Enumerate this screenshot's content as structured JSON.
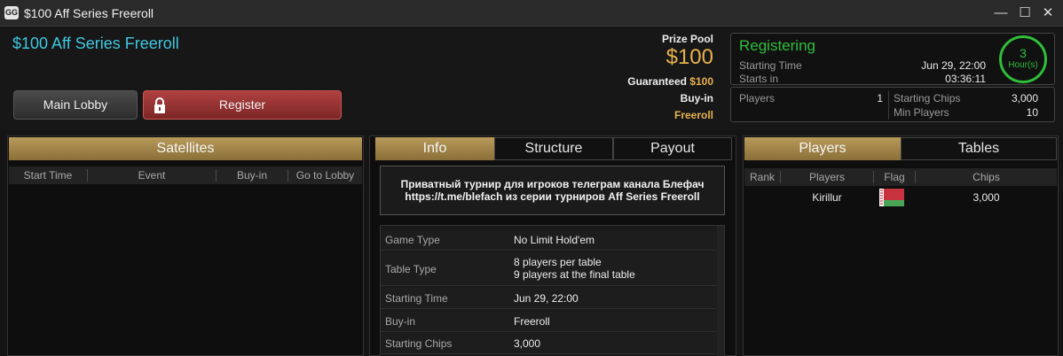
{
  "window": {
    "logo": "GG",
    "title": "$100 Aff Series Freeroll",
    "controls": {
      "minimize": "—",
      "maximize": "☐",
      "close": "✕"
    }
  },
  "tournament": {
    "name": "$100 Aff Series Freeroll",
    "main_lobby": "Main Lobby",
    "register": "Register"
  },
  "prize": {
    "pool_label": "Prize Pool",
    "pool_value": "$100",
    "guaranteed_label": "Guaranteed",
    "guaranteed_value": "$100",
    "buyin_label": "Buy-in",
    "buyin_value": "Freeroll"
  },
  "status": {
    "title": "Registering",
    "starting_time_label": "Starting Time",
    "starting_time_value": "Jun 29, 22:00",
    "starts_in_label": "Starts in",
    "starts_in_value": "03:36:11",
    "countdown_number": "3",
    "countdown_unit": "Hour(s)"
  },
  "stats": {
    "players_label": "Players",
    "players_value": "1",
    "starting_chips_label": "Starting Chips",
    "starting_chips_value": "3,000",
    "min_players_label": "Min Players",
    "min_players_value": "10"
  },
  "satellites": {
    "title": "Satellites",
    "columns": [
      "Start Time",
      "Event",
      "Buy-in",
      "Go to Lobby"
    ]
  },
  "info": {
    "tabs": [
      "Info",
      "Structure",
      "Payout"
    ],
    "active_tab": "Info",
    "description_line1": "Приватный турнир для игроков телеграм канала Блефач",
    "description_line2": "https://t.me/blefach из серии турниров Aff Series Freeroll",
    "rows": [
      {
        "key": "Game Type",
        "value": "No Limit Hold'em"
      },
      {
        "key": "Table Type",
        "value": "8 players per table",
        "value2": "9 players at the final table"
      },
      {
        "key": "Starting Time",
        "value": "Jun 29, 22:00"
      },
      {
        "key": "Buy-in",
        "value": "Freeroll"
      },
      {
        "key": "Starting Chips",
        "value": "3,000"
      }
    ]
  },
  "players_panel": {
    "tabs": [
      "Players",
      "Tables"
    ],
    "active_tab": "Players",
    "columns": [
      "Rank",
      "Players",
      "Flag",
      "Chips"
    ],
    "rows": [
      {
        "rank": "",
        "player": "Kirillur",
        "flag": "belarus-flag",
        "chips": "3,000"
      }
    ]
  },
  "colors": {
    "accent_cyan": "#3fc7e0",
    "prize_gold": "#e8b24e",
    "status_green": "#2fbe3a",
    "register_red": "#9a3232",
    "tab_gold": "#a98a4a"
  }
}
